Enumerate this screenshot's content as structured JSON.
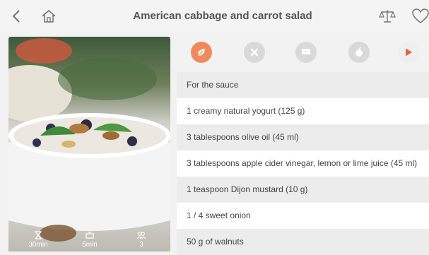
{
  "header": {
    "title": "American cabbage and carrot salad",
    "icons": [
      "back-chevron-icon",
      "home-icon",
      "scale-icon",
      "heart-icon"
    ]
  },
  "recipe_stats": {
    "total_time": "30min",
    "cook_time": "5min",
    "servings": "3"
  },
  "tabs": [
    {
      "name": "ingredients-tab",
      "icon": "leaf-icon",
      "active": true,
      "color": "#f08a5d"
    },
    {
      "name": "utensils-tab",
      "icon": "cross-icon",
      "active": false,
      "color": "#d9d9d9"
    },
    {
      "name": "steps-tab",
      "icon": "chat-icon",
      "active": false,
      "color": "#d9d9d9"
    },
    {
      "name": "nutrition-tab",
      "icon": "apple-icon",
      "active": false,
      "color": "#d9d9d9"
    },
    {
      "name": "video-tab",
      "icon": "play-icon",
      "active": false,
      "color": "#e8603c"
    }
  ],
  "ingredients": [
    "For the sauce",
    "1 creamy natural yogurt (125 g)",
    "3 tablespoons olive oil (45 ml)",
    "3 tablespoons apple cider vinegar, lemon or lime juice (45 ml)",
    "1 teaspoon Dijon mustard (10 g)",
    "1 / 4 sweet onion",
    "50 g of walnuts"
  ],
  "colors": {
    "accent": "#f08a5d",
    "play": "#e8603c",
    "text": "#444444"
  }
}
